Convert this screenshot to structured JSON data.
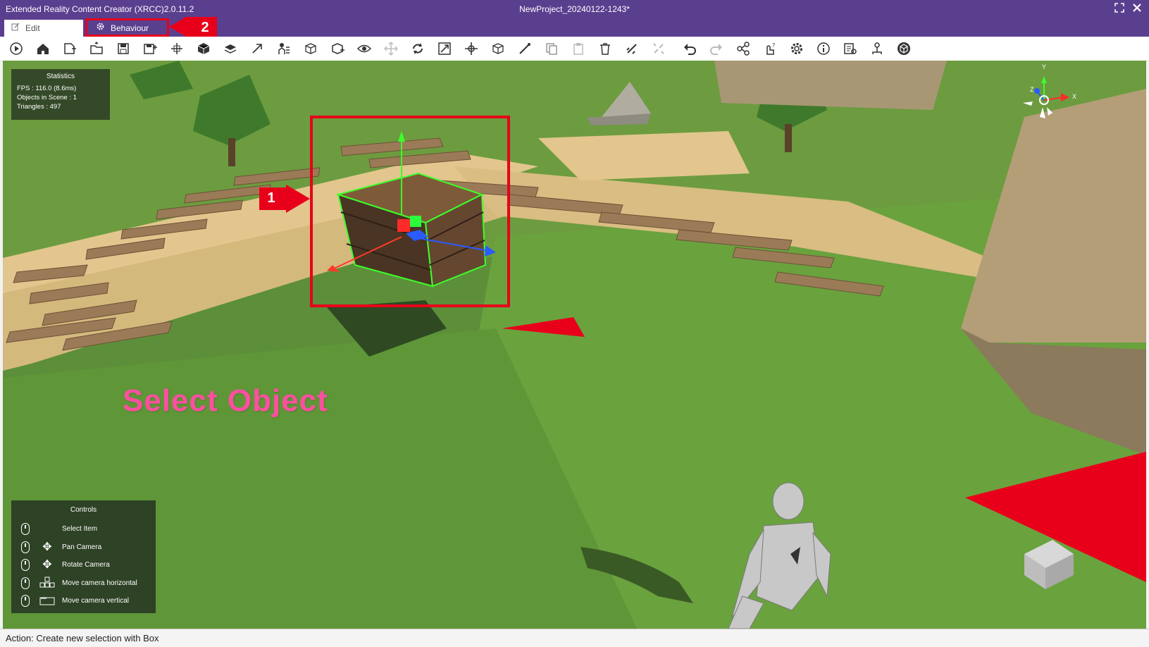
{
  "window": {
    "app_title": "Extended Reality Content Creator (XRCC)2.0.11.2",
    "project_title": "NewProject_20240122-1243*"
  },
  "tabs": [
    {
      "label": "Edit"
    },
    {
      "label": "Behaviour"
    }
  ],
  "toolbar": {
    "icons": [
      "play-icon",
      "home-icon",
      "new-file-icon",
      "open-folder-icon",
      "save-icon",
      "save-as-icon",
      "import-icon",
      "cube-box-icon",
      "layers-icon",
      "export-icon",
      "rig-icon",
      "model-icon",
      "add-object-icon",
      "eye-icon",
      "move-icon",
      "rotate-icon",
      "scale-icon",
      "transform-icon",
      "pivot-icon",
      "measure-icon",
      "copy-icon",
      "paste-icon",
      "delete-icon",
      "link-icon",
      "unlink-icon",
      "undo-icon",
      "redo-icon",
      "share-icon",
      "interaction-icon",
      "settings-icon",
      "info-icon",
      "report-icon",
      "hierarchy-icon",
      "unity-icon"
    ]
  },
  "statistics": {
    "title": "Statistics",
    "fps": "FPS : 116.0 (8.6ms)",
    "objects": "Objects in Scene : 1",
    "triangles": "Triangles : 497"
  },
  "controls": {
    "title": "Controls",
    "items": [
      {
        "label": "Select Item"
      },
      {
        "label": "Pan Camera"
      },
      {
        "label": "Rotate Camera"
      },
      {
        "label": "Move camera horizontal"
      },
      {
        "label": "Move camera vertical"
      }
    ]
  },
  "annotations": {
    "marker_1": "1",
    "marker_2": "2",
    "select_object": "Select Object"
  },
  "gizmo": {
    "x": "X",
    "y": "Y",
    "z": "Z"
  },
  "status": {
    "action": "Action: Create new selection with Box"
  },
  "colors": {
    "title_bar": "#5b3f8f",
    "annotation_red": "#e8001a",
    "annotation_pink": "#ff4fa0",
    "grass": "#5d8f3a",
    "selection_green": "#3cff2a"
  }
}
